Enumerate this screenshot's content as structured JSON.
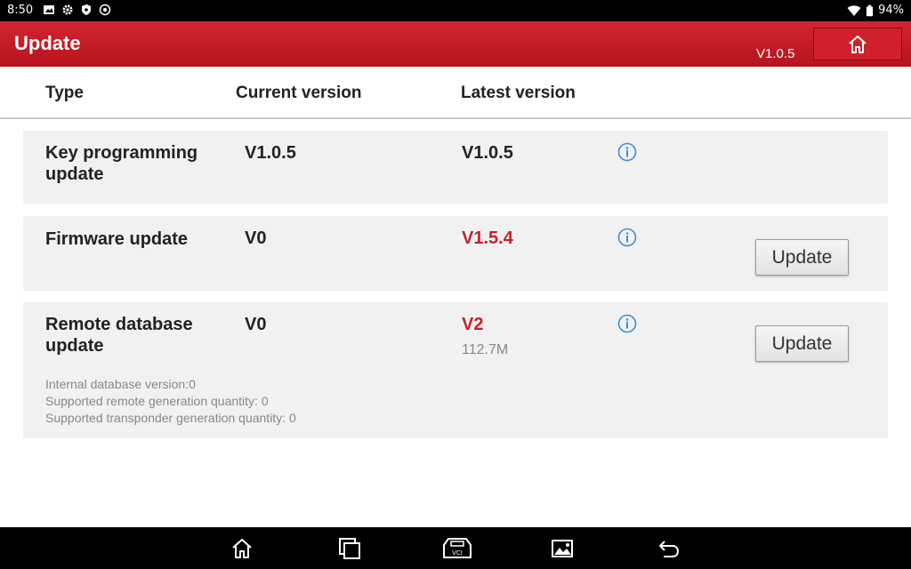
{
  "status_bar": {
    "time": "8:50",
    "battery": "94%",
    "icons": [
      "gallery-icon",
      "gear-icon",
      "shield-icon",
      "vpn-icon",
      "wifi-icon",
      "battery-icon"
    ]
  },
  "header": {
    "title": "Update",
    "version": "V1.0.5",
    "home_icon": "home-icon"
  },
  "columns": {
    "type": "Type",
    "current": "Current version",
    "latest": "Latest version"
  },
  "rows": [
    {
      "type": "Key programming update",
      "current": "V1.0.5",
      "latest": "V1.0.5",
      "latest_highlight": false,
      "info_icon": "info-icon"
    },
    {
      "type": "Firmware update",
      "current": "V0",
      "latest": "V1.5.4",
      "latest_highlight": true,
      "info_icon": "info-icon",
      "button": "Update"
    },
    {
      "type": "Remote database update",
      "current": "V0",
      "latest": "V2",
      "latest_highlight": true,
      "size": "112.7M",
      "info_icon": "info-icon",
      "button": "Update",
      "details": [
        "Internal database version:0",
        "Supported remote generation quantity: 0",
        "Supported transponder generation quantity: 0"
      ]
    }
  ],
  "nav_bar": {
    "icons": [
      "home-icon",
      "recent-apps-icon",
      "vci-icon",
      "screenshot-icon",
      "back-icon"
    ]
  },
  "colors": {
    "accent": "#c8202c",
    "header_top": "#d32531",
    "header_bottom": "#b5141e",
    "card_bg": "#f1f1f1",
    "info_blue": "#3a8fd6"
  }
}
